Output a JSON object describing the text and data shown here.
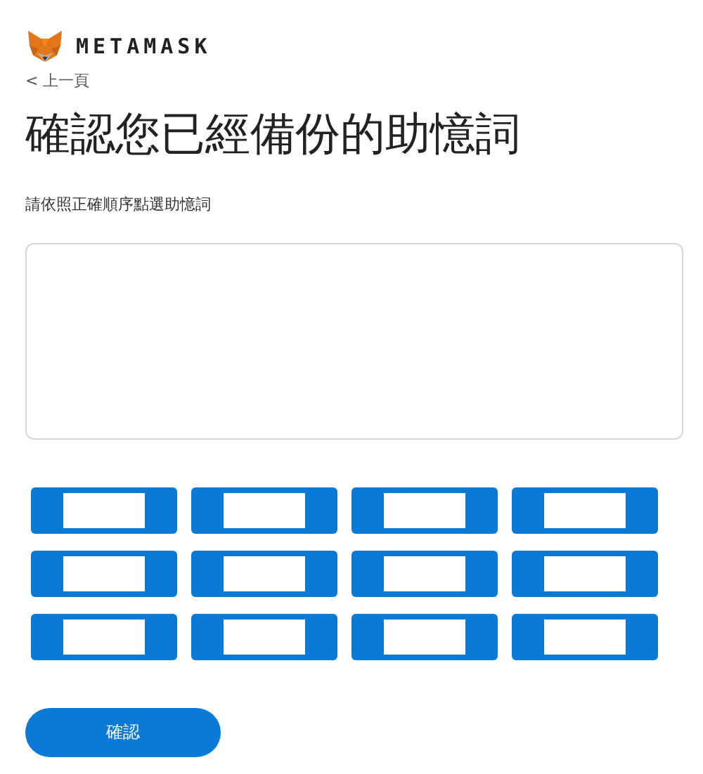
{
  "header": {
    "brand": "METAMASK",
    "back_link": "< 上一頁"
  },
  "title": "確認您已經備份的助憶詞",
  "instruction": "請依照正確順序點選助憶詞",
  "word_buttons": [
    {
      "kind": "redacted"
    },
    {
      "kind": "redacted"
    },
    {
      "kind": "redacted"
    },
    {
      "kind": "redacted"
    },
    {
      "kind": "redacted"
    },
    {
      "kind": "redacted"
    },
    {
      "kind": "redacted"
    },
    {
      "kind": "redacted"
    },
    {
      "kind": "redacted"
    },
    {
      "kind": "redacted"
    },
    {
      "kind": "redacted"
    },
    {
      "kind": "redacted"
    }
  ],
  "confirm_button": "確認"
}
